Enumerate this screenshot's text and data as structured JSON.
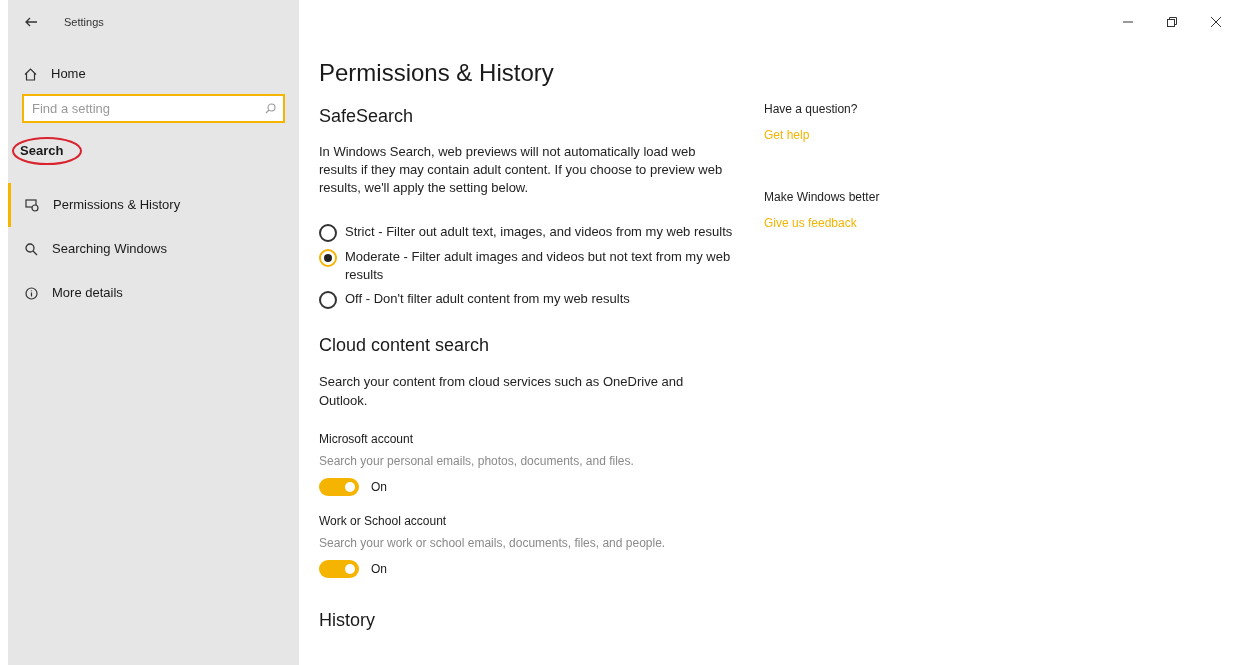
{
  "window": {
    "title": "Settings"
  },
  "sidebar": {
    "home": "Home",
    "search": {
      "placeholder": "Find a setting"
    },
    "section": "Search",
    "annotated": true,
    "items": [
      {
        "label": "Permissions & History",
        "kind": "permissions",
        "selected": true
      },
      {
        "label": "Searching Windows",
        "kind": "search",
        "selected": false
      },
      {
        "label": "More details",
        "kind": "info",
        "selected": false
      }
    ]
  },
  "page": {
    "title": "Permissions & History",
    "safesearch": {
      "heading": "SafeSearch",
      "description": "In Windows Search, web previews will not automatically load web results if they may contain adult content. If you choose to preview web results, we'll apply the setting below.",
      "options": [
        {
          "label": "Strict - Filter out adult text, images, and videos from my web results",
          "selected": false
        },
        {
          "label": "Moderate - Filter adult images and videos but not text from my web results",
          "selected": true
        },
        {
          "label": "Off - Don't filter adult content from my web results",
          "selected": false
        }
      ]
    },
    "cloud": {
      "heading": "Cloud content search",
      "description": "Search your content from cloud services such as OneDrive and Outlook.",
      "accounts": [
        {
          "title": "Microsoft account",
          "description": "Search your personal emails, photos, documents, and files.",
          "on": true,
          "state": "On"
        },
        {
          "title": "Work or School account",
          "description": "Search your work or school emails, documents, files, and people.",
          "on": true,
          "state": "On"
        }
      ]
    },
    "history": {
      "heading": "History"
    }
  },
  "aside": [
    {
      "heading": "Have a question?",
      "link": "Get help"
    },
    {
      "heading": "Make Windows better",
      "link": "Give us feedback"
    }
  ]
}
